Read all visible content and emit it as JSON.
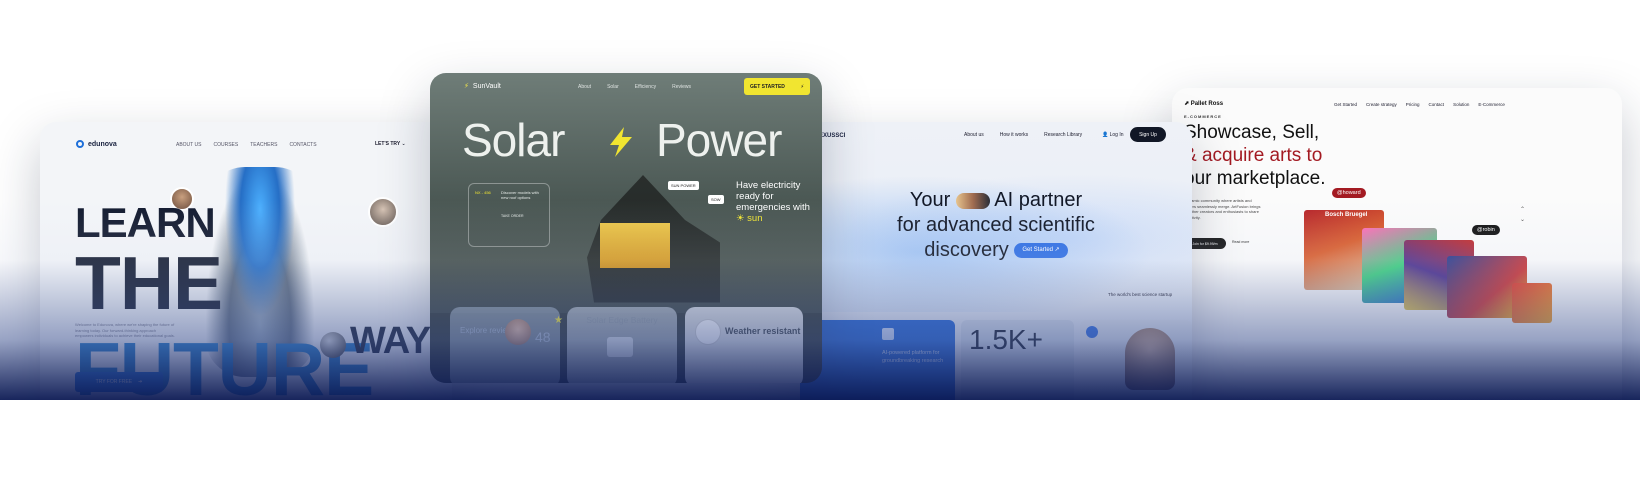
{
  "edunova": {
    "logo": "edunova",
    "nav": [
      "ABOUT US",
      "COURSES",
      "TEACHERS",
      "CONTACTS"
    ],
    "cta_top": "LET'S TRY",
    "headline_1": "LEARN",
    "headline_2a": "THE ",
    "headline_2b": "FUTURE",
    "headline_3": "WAY",
    "paragraph": "Welcome to Edunova, where we're shaping the future of learning today. Our forward-thinking approach empowers individuals to achieve their educational goals.",
    "cta": "TRY FOR FREE"
  },
  "sunvault": {
    "brand": "SunVault",
    "nav": [
      "About",
      "Solar",
      "Efficiency",
      "Reviews"
    ],
    "get_started": "GET STARTED",
    "title_left": "Solar",
    "title_right": "Power",
    "side_text": "Have electricity ready for emergencies with",
    "side_sun": "sun",
    "panel_model": "NX - 456",
    "panel_text": "Discover models with new roof options",
    "panel_order": "TAKE ORDER",
    "tag_1": "SUN POWER",
    "tag_2": "SOW",
    "tile_1_label": "Explore reviews",
    "tile_1_num": "48",
    "tile_2_label": "Solar Edge Battery",
    "tile_3_label": "Weather resistant"
  },
  "nexussci": {
    "brand": "NEXUSSCI",
    "nav": [
      "About us",
      "How it works",
      "Research Library"
    ],
    "login": "Log In",
    "signup": "Sign Up",
    "head_1a": "Your",
    "head_1b": "AI partner",
    "head_2": "for advanced scientific",
    "head_3": "discovery",
    "get_started": "Get Started",
    "best": "The world's best science startup",
    "tile_text": "AI-powered platform for groundbreaking research",
    "stat": "1.5K+"
  },
  "palletross": {
    "brand": "Pallet Ross",
    "nav": [
      "Get Started",
      "Create strategy",
      "Pricing",
      "Contact",
      "Solution",
      "E-Commerce"
    ],
    "eyebrow": "E-COMMERCE",
    "head_1": "Showcase, Sell,",
    "head_2": "& acquire arts to",
    "head_3": "our marketplace.",
    "paragraph": "Dynamic community where artists and buyers seamlessly merge. ArtFusion brings together creators and enthusiasts to share creativity.",
    "btn_join": "Join for $9.99/m",
    "btn_read": "Read more",
    "bubble_1": "@howard",
    "bubble_2": "@robin",
    "art_text": "Bosch Bruegel"
  }
}
